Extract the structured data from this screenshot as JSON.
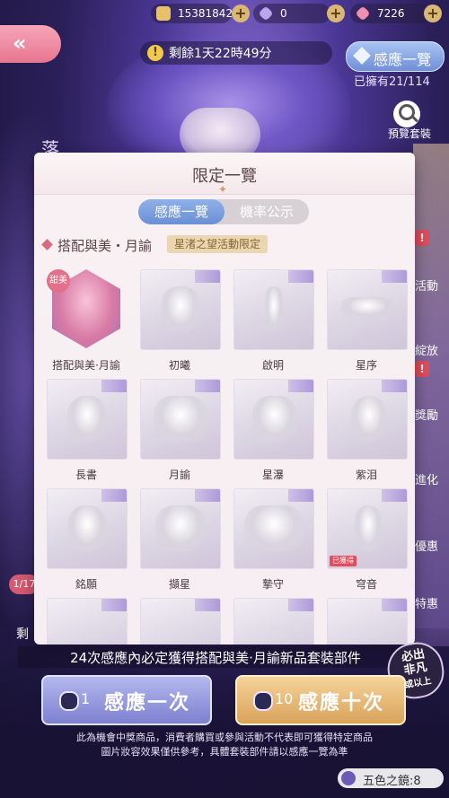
{
  "currency": {
    "gold": "15381842",
    "diamond_blue": "0",
    "diamond_pink": "7226"
  },
  "timer": {
    "text": "剩餘1天22時49分"
  },
  "view_all": {
    "label": "感應一覽",
    "owned": "已擁有21/114"
  },
  "preview": {
    "label": "預覽套裝"
  },
  "right_side": [
    "活動",
    "綻放",
    "獎勵",
    "進化",
    "優惠",
    "特惠"
  ],
  "left_side": {
    "counter": "1/17",
    "char": "剩"
  },
  "bg_title": "落",
  "modal": {
    "title": "限定一覽",
    "tabs": [
      {
        "label": "感應一覽"
      },
      {
        "label": "機率公示"
      }
    ],
    "section_title": "搭配與美・月諭",
    "section_badge": "星渚之望活動限定",
    "items": [
      {
        "name": "搭配與美·月諭",
        "tag": "甜美"
      },
      {
        "name": "初曦"
      },
      {
        "name": "啟明"
      },
      {
        "name": "星序"
      },
      {
        "name": "長書"
      },
      {
        "name": "月諭"
      },
      {
        "name": "星瀑"
      },
      {
        "name": "紫泪"
      },
      {
        "name": "銘願"
      },
      {
        "name": "擷星"
      },
      {
        "name": "摯守"
      },
      {
        "name": "穹音",
        "status": "已獲得"
      }
    ]
  },
  "guarantee_text": "24次感應內必定獲得搭配與美·月諭新品套裝部件",
  "stamp": {
    "line1": "必出",
    "line2": "非凡",
    "line3": "或以上"
  },
  "buttons": {
    "single": {
      "count": "1",
      "label": "感應一次"
    },
    "ten": {
      "count": "10",
      "label": "感應十次"
    }
  },
  "disclaimer": [
    "此為機會中獎商品，消費者購買或參與活動不代表即可獲得特定商品",
    "圖片妝容效果僅供參考，具體套裝部件請以感應一覽為準"
  ],
  "mirror": {
    "label": "五色之鏡:8"
  }
}
